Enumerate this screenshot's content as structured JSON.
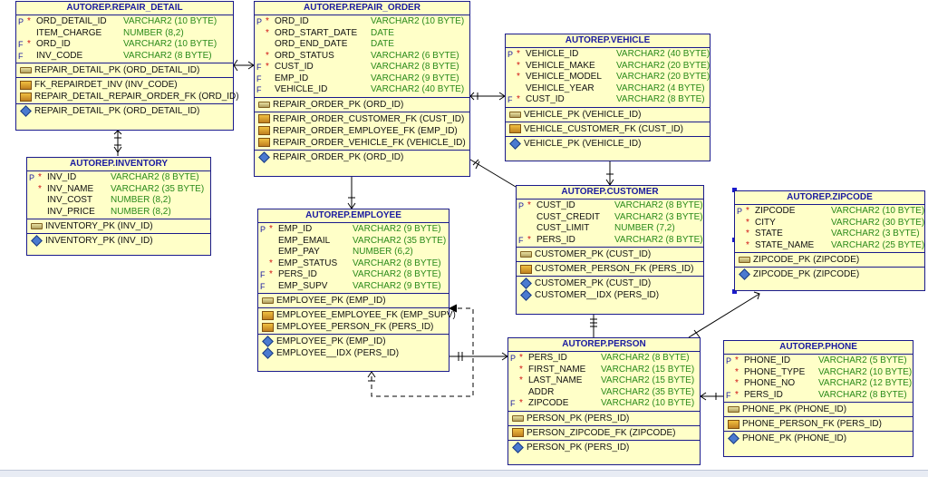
{
  "tables": {
    "repair_detail": {
      "title": "AUTOREP.REPAIR_DETAIL",
      "columns": [
        {
          "flag": "P",
          "req": true,
          "name": "ORD_DETAIL_ID",
          "type": "VARCHAR2 (10 BYTE)"
        },
        {
          "flag": "",
          "req": false,
          "name": "ITEM_CHARGE",
          "type": "NUMBER (8,2)"
        },
        {
          "flag": "F",
          "req": true,
          "name": "ORD_ID",
          "type": "VARCHAR2 (10 BYTE)"
        },
        {
          "flag": "F",
          "req": false,
          "name": "INV_CODE",
          "type": "VARCHAR2 (8 BYTE)"
        }
      ],
      "pks": [
        "REPAIR_DETAIL_PK (ORD_DETAIL_ID)"
      ],
      "fks": [
        "FK_REPAIRDET_INV (INV_CODE)",
        "REPAIR_DETAIL_REPAIR_ORDER_FK (ORD_ID)"
      ],
      "idx": [
        "REPAIR_DETAIL_PK (ORD_DETAIL_ID)"
      ]
    },
    "repair_order": {
      "title": "AUTOREP.REPAIR_ORDER",
      "columns": [
        {
          "flag": "P",
          "req": true,
          "name": "ORD_ID",
          "type": "VARCHAR2 (10 BYTE)"
        },
        {
          "flag": "",
          "req": true,
          "name": "ORD_START_DATE",
          "type": "DATE"
        },
        {
          "flag": "",
          "req": false,
          "name": "ORD_END_DATE",
          "type": "DATE"
        },
        {
          "flag": "",
          "req": true,
          "name": "ORD_STATUS",
          "type": "VARCHAR2 (6 BYTE)"
        },
        {
          "flag": "F",
          "req": true,
          "name": "CUST_ID",
          "type": "VARCHAR2 (8 BYTE)"
        },
        {
          "flag": "F",
          "req": false,
          "name": "EMP_ID",
          "type": "VARCHAR2 (9 BYTE)"
        },
        {
          "flag": "F",
          "req": false,
          "name": "VEHICLE_ID",
          "type": "VARCHAR2 (40 BYTE)"
        }
      ],
      "pks": [
        "REPAIR_ORDER_PK (ORD_ID)"
      ],
      "fks": [
        "REPAIR_ORDER_CUSTOMER_FK (CUST_ID)",
        "REPAIR_ORDER_EMPLOYEE_FK (EMP_ID)",
        "REPAIR_ORDER_VEHICLE_FK (VEHICLE_ID)"
      ],
      "idx": [
        "REPAIR_ORDER_PK (ORD_ID)"
      ]
    },
    "vehicle": {
      "title": "AUTOREP.VEHICLE",
      "columns": [
        {
          "flag": "P",
          "req": true,
          "name": "VEHICLE_ID",
          "type": "VARCHAR2 (40 BYTE)"
        },
        {
          "flag": "",
          "req": true,
          "name": "VEHICLE_MAKE",
          "type": "VARCHAR2 (20 BYTE)"
        },
        {
          "flag": "",
          "req": true,
          "name": "VEHICLE_MODEL",
          "type": "VARCHAR2 (20 BYTE)"
        },
        {
          "flag": "",
          "req": false,
          "name": "VEHICLE_YEAR",
          "type": "VARCHAR2 (4 BYTE)"
        },
        {
          "flag": "F",
          "req": true,
          "name": "CUST_ID",
          "type": "VARCHAR2 (8 BYTE)"
        }
      ],
      "pks": [
        "VEHICLE_PK (VEHICLE_ID)"
      ],
      "fks": [
        "VEHICLE_CUSTOMER_FK (CUST_ID)"
      ],
      "idx": [
        "VEHICLE_PK (VEHICLE_ID)"
      ]
    },
    "inventory": {
      "title": "AUTOREP.INVENTORY",
      "columns": [
        {
          "flag": "P",
          "req": true,
          "name": "INV_ID",
          "type": "VARCHAR2 (8 BYTE)"
        },
        {
          "flag": "",
          "req": true,
          "name": "INV_NAME",
          "type": "VARCHAR2 (35 BYTE)"
        },
        {
          "flag": "",
          "req": false,
          "name": "INV_COST",
          "type": "NUMBER (8,2)"
        },
        {
          "flag": "",
          "req": false,
          "name": "INV_PRICE",
          "type": "NUMBER (8,2)"
        }
      ],
      "pks": [
        "INVENTORY_PK (INV_ID)"
      ],
      "fks": [],
      "idx": [
        "INVENTORY_PK (INV_ID)"
      ]
    },
    "employee": {
      "title": "AUTOREP.EMPLOYEE",
      "columns": [
        {
          "flag": "P",
          "req": true,
          "name": "EMP_ID",
          "type": "VARCHAR2 (9 BYTE)"
        },
        {
          "flag": "",
          "req": false,
          "name": "EMP_EMAIL",
          "type": "VARCHAR2 (35 BYTE)"
        },
        {
          "flag": "",
          "req": false,
          "name": "EMP_PAY",
          "type": "NUMBER (6,2)"
        },
        {
          "flag": "",
          "req": true,
          "name": "EMP_STATUS",
          "type": "VARCHAR2 (8 BYTE)"
        },
        {
          "flag": "F",
          "req": true,
          "name": "PERS_ID",
          "type": "VARCHAR2 (8 BYTE)"
        },
        {
          "flag": "F",
          "req": false,
          "name": "EMP_SUPV",
          "type": "VARCHAR2 (9 BYTE)"
        }
      ],
      "pks": [
        "EMPLOYEE_PK (EMP_ID)"
      ],
      "fks": [
        "EMPLOYEE_EMPLOYEE_FK (EMP_SUPV)",
        "EMPLOYEE_PERSON_FK (PERS_ID)"
      ],
      "idx": [
        "EMPLOYEE_PK (EMP_ID)",
        "EMPLOYEE__IDX (PERS_ID)"
      ]
    },
    "customer": {
      "title": "AUTOREP.CUSTOMER",
      "columns": [
        {
          "flag": "P",
          "req": true,
          "name": "CUST_ID",
          "type": "VARCHAR2 (8 BYTE)"
        },
        {
          "flag": "",
          "req": false,
          "name": "CUST_CREDIT",
          "type": "VARCHAR2 (3 BYTE)"
        },
        {
          "flag": "",
          "req": false,
          "name": "CUST_LIMIT",
          "type": "NUMBER (7,2)"
        },
        {
          "flag": "F",
          "req": true,
          "name": "PERS_ID",
          "type": "VARCHAR2 (8 BYTE)"
        }
      ],
      "pks": [
        "CUSTOMER_PK (CUST_ID)"
      ],
      "fks": [
        "CUSTOMER_PERSON_FK (PERS_ID)"
      ],
      "idx": [
        "CUSTOMER_PK (CUST_ID)",
        "CUSTOMER__IDX (PERS_ID)"
      ]
    },
    "zipcode": {
      "title": "AUTOREP.ZIPCODE",
      "columns": [
        {
          "flag": "P",
          "req": true,
          "name": "ZIPCODE",
          "type": "VARCHAR2 (10 BYTE)"
        },
        {
          "flag": "",
          "req": true,
          "name": "CITY",
          "type": "VARCHAR2 (30 BYTE)"
        },
        {
          "flag": "",
          "req": true,
          "name": "STATE",
          "type": "VARCHAR2 (3 BYTE)"
        },
        {
          "flag": "",
          "req": true,
          "name": "STATE_NAME",
          "type": "VARCHAR2 (25 BYTE)"
        }
      ],
      "pks": [
        "ZIPCODE_PK (ZIPCODE)"
      ],
      "fks": [],
      "idx": [
        "ZIPCODE_PK (ZIPCODE)"
      ]
    },
    "person": {
      "title": "AUTOREP.PERSON",
      "columns": [
        {
          "flag": "P",
          "req": true,
          "name": "PERS_ID",
          "type": "VARCHAR2 (8 BYTE)"
        },
        {
          "flag": "",
          "req": true,
          "name": "FIRST_NAME",
          "type": "VARCHAR2 (15 BYTE)"
        },
        {
          "flag": "",
          "req": true,
          "name": "LAST_NAME",
          "type": "VARCHAR2 (15 BYTE)"
        },
        {
          "flag": "",
          "req": false,
          "name": "ADDR",
          "type": "VARCHAR2 (35 BYTE)"
        },
        {
          "flag": "F",
          "req": true,
          "name": "ZIPCODE",
          "type": "VARCHAR2 (10 BYTE)"
        }
      ],
      "pks": [
        "PERSON_PK (PERS_ID)"
      ],
      "fks": [
        "PERSON_ZIPCODE_FK (ZIPCODE)"
      ],
      "idx": [
        "PERSON_PK (PERS_ID)"
      ]
    },
    "phone": {
      "title": "AUTOREP.PHONE",
      "columns": [
        {
          "flag": "P",
          "req": true,
          "name": "PHONE_ID",
          "type": "VARCHAR2 (5 BYTE)"
        },
        {
          "flag": "",
          "req": true,
          "name": "PHONE_TYPE",
          "type": "VARCHAR2 (10 BYTE)"
        },
        {
          "flag": "",
          "req": true,
          "name": "PHONE_NO",
          "type": "VARCHAR2 (12 BYTE)"
        },
        {
          "flag": "F",
          "req": true,
          "name": "PERS_ID",
          "type": "VARCHAR2 (8 BYTE)"
        }
      ],
      "pks": [
        "PHONE_PK (PHONE_ID)"
      ],
      "fks": [
        "PHONE_PERSON_FK (PERS_ID)"
      ],
      "idx": [
        "PHONE_PK (PHONE_ID)"
      ]
    }
  },
  "colors": {
    "table_bg": "#ffffc8",
    "border": "#1a1a8c",
    "title": "#1a1aa0",
    "type_text": "#2a8a1a",
    "required_star": "#d01010"
  }
}
